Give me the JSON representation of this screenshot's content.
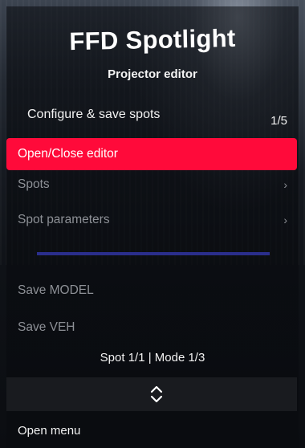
{
  "header": {
    "title": "FFD Spotlight",
    "subtitle": "Projector editor"
  },
  "menu": {
    "title": "Configure & save spots",
    "counter": "1/5",
    "items": [
      {
        "label": "Open/Close editor",
        "selected": true,
        "submenu": false
      },
      {
        "label": "Spots",
        "selected": false,
        "submenu": true
      },
      {
        "label": "Spot parameters",
        "selected": false,
        "submenu": true
      },
      {
        "label": "Save MODEL",
        "selected": false,
        "submenu": false
      },
      {
        "label": "Save VEH",
        "selected": false,
        "submenu": false
      }
    ],
    "arrow_glyph": "›"
  },
  "footer": {
    "mode_line": "Spot 1/1 | Mode 1/3",
    "open_menu": "Open menu"
  },
  "colors": {
    "selected_bg": "#ff0a3a",
    "separator": "#2a2e8c",
    "text_dim": "#8d9096",
    "text_light": "#f2f2f2"
  },
  "icons": {
    "scroll": "up-down-chevron-icon"
  }
}
